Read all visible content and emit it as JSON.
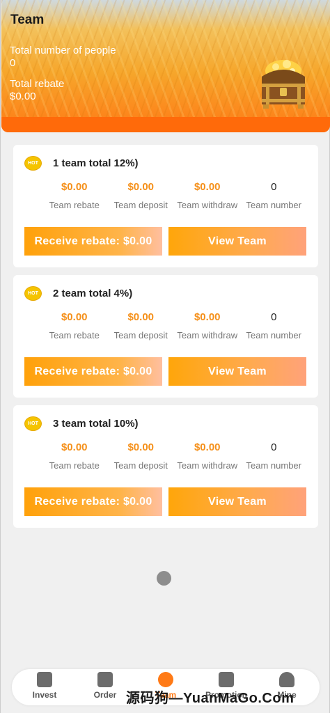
{
  "header": {
    "title": "Team",
    "total_people_label": "Total number of people",
    "total_people_value": "0",
    "total_rebate_label": "Total rebate",
    "total_rebate_value": "$0.00"
  },
  "cards": [
    {
      "badge": "HOT",
      "title": "1 team total 12%)",
      "metrics": [
        {
          "value": "$0.00",
          "label": "Team rebate"
        },
        {
          "value": "$0.00",
          "label": "Team deposit"
        },
        {
          "value": "$0.00",
          "label": "Team withdraw"
        },
        {
          "value": "0",
          "label": "Team number"
        }
      ],
      "receive_label": "Receive rebate: $0.00",
      "view_label": "View Team"
    },
    {
      "badge": "HOT",
      "title": "2 team total 4%)",
      "metrics": [
        {
          "value": "$0.00",
          "label": "Team rebate"
        },
        {
          "value": "$0.00",
          "label": "Team deposit"
        },
        {
          "value": "$0.00",
          "label": "Team withdraw"
        },
        {
          "value": "0",
          "label": "Team number"
        }
      ],
      "receive_label": "Receive rebate: $0.00",
      "view_label": "View Team"
    },
    {
      "badge": "HOT",
      "title": "3 team total 10%)",
      "metrics": [
        {
          "value": "$0.00",
          "label": "Team rebate"
        },
        {
          "value": "$0.00",
          "label": "Team deposit"
        },
        {
          "value": "$0.00",
          "label": "Team withdraw"
        },
        {
          "value": "0",
          "label": "Team number"
        }
      ],
      "receive_label": "Receive rebate: $0.00",
      "view_label": "View Team"
    }
  ],
  "tabbar": {
    "items": [
      {
        "label": "Invest",
        "icon": "home-icon"
      },
      {
        "label": "Order",
        "icon": "chart-icon"
      },
      {
        "label": "Team",
        "icon": "team-icon",
        "active": true
      },
      {
        "label": "Promotion",
        "icon": "bar-chart-icon"
      },
      {
        "label": "Mine",
        "icon": "user-icon"
      }
    ]
  },
  "watermark": "源码狗—YuanMaGo.Com",
  "colors": {
    "accent": "#ff7a16",
    "value_orange": "#f5901a",
    "button_orange": "#ffa10a",
    "background": "#f0f0f0"
  }
}
